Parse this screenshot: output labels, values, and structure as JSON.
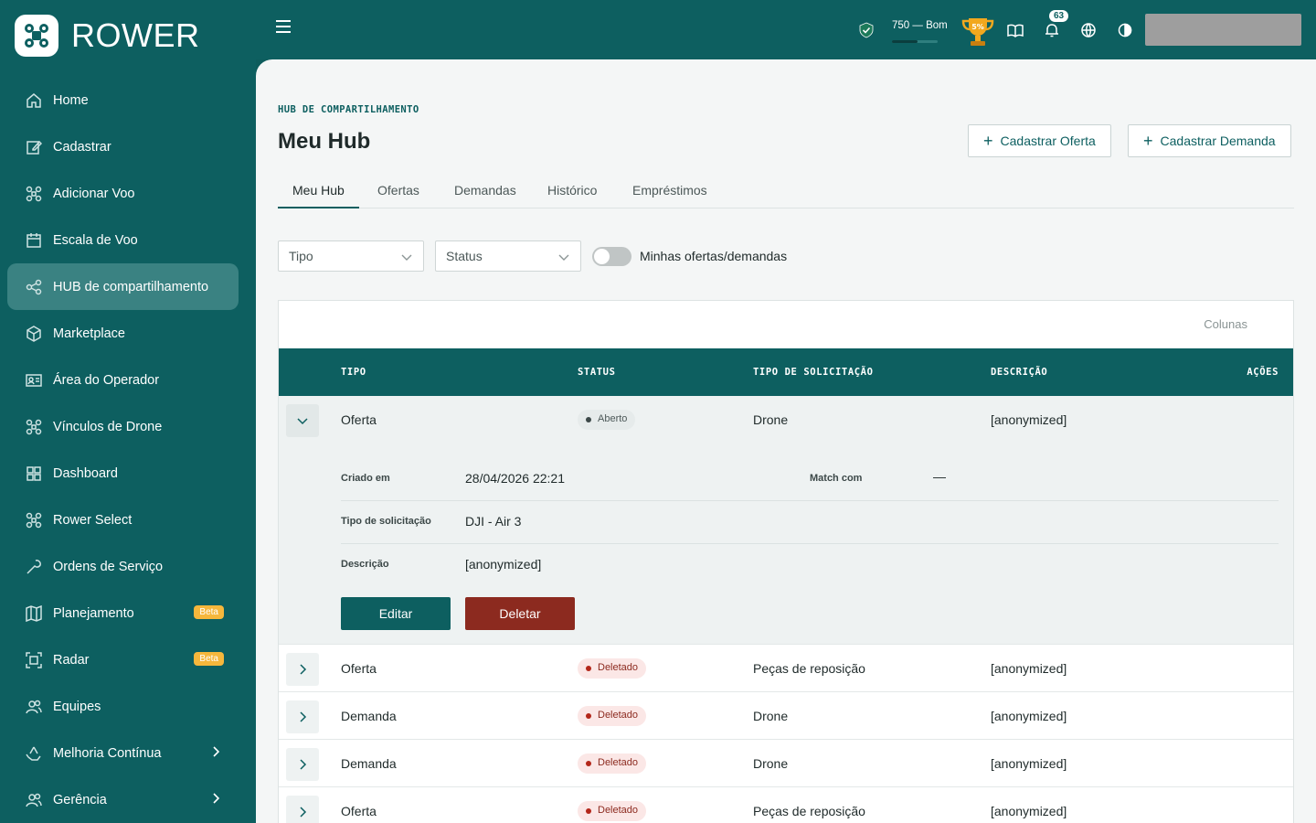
{
  "brand": {
    "name": "ROWER"
  },
  "sidebar": {
    "items": [
      {
        "label": "Home",
        "icon": "home-icon"
      },
      {
        "label": "Cadastrar",
        "icon": "edit-icon"
      },
      {
        "label": "Adicionar Voo",
        "icon": "drone-icon"
      },
      {
        "label": "Escala de Voo",
        "icon": "calendar-icon"
      },
      {
        "label": "HUB de compartilhamento",
        "icon": "share-icon",
        "active": true
      },
      {
        "label": "Marketplace",
        "icon": "box-icon"
      },
      {
        "label": "Área do Operador",
        "icon": "id-card-icon"
      },
      {
        "label": "Vínculos de Drone",
        "icon": "drone-icon"
      },
      {
        "label": "Dashboard",
        "icon": "grid-icon"
      },
      {
        "label": "Rower Select",
        "icon": "drone-icon"
      },
      {
        "label": "Ordens de Serviço",
        "icon": "wrench-icon"
      },
      {
        "label": "Planejamento",
        "icon": "map-icon",
        "badge": "Beta"
      },
      {
        "label": "Radar",
        "icon": "radar-icon",
        "badge": "Beta"
      },
      {
        "label": "Equipes",
        "icon": "team-icon"
      },
      {
        "label": "Melhoria Contínua",
        "icon": "recycle-icon",
        "chevron": true
      },
      {
        "label": "Gerência",
        "icon": "team-icon",
        "chevron": true
      }
    ]
  },
  "topbar": {
    "score_text": "750 — Bom",
    "score_fraction": 0.56,
    "trophy_badge": "5%",
    "notifications_count": "63"
  },
  "page": {
    "overline": "HUB DE COMPARTILHAMENTO",
    "title": "Meu Hub",
    "actions": {
      "offer": "Cadastrar Oferta",
      "demand": "Cadastrar Demanda"
    },
    "tabs": [
      "Meu Hub",
      "Ofertas",
      "Demandas",
      "Histórico",
      "Empréstimos"
    ],
    "filters": {
      "type": "Tipo",
      "status": "Status",
      "toggle_label": "Minhas ofertas/demandas"
    }
  },
  "table": {
    "columns_button": "Colunas",
    "headers": [
      "TIPO",
      "STATUS",
      "TIPO DE SOLICITAÇÃO",
      "DESCRIÇÃO",
      "AÇÕES"
    ],
    "rows": [
      {
        "tipo": "Oferta",
        "status": "Aberto",
        "status_kind": "open",
        "solicitacao": "Drone",
        "descricao": "[anonymized]",
        "expanded": true
      },
      {
        "tipo": "Oferta",
        "status": "Deletado",
        "status_kind": "deleted",
        "solicitacao": "Peças de reposição",
        "descricao": "[anonymized]"
      },
      {
        "tipo": "Demanda",
        "status": "Deletado",
        "status_kind": "deleted",
        "solicitacao": "Drone",
        "descricao": "[anonymized]"
      },
      {
        "tipo": "Demanda",
        "status": "Deletado",
        "status_kind": "deleted",
        "solicitacao": "Drone",
        "descricao": "[anonymized]"
      },
      {
        "tipo": "Oferta",
        "status": "Deletado",
        "status_kind": "deleted",
        "solicitacao": "Peças de reposição",
        "descricao": "[anonymized]"
      }
    ],
    "detail": {
      "created_label": "Criado em",
      "created_value": "28/04/2026 22:21",
      "match_label": "Match com",
      "match_value": "—",
      "request_label": "Tipo de solicitação",
      "request_value": "DJI - Air 3",
      "desc_label": "Descrição",
      "desc_value": "[anonymized]",
      "edit": "Editar",
      "delete": "Deletar"
    }
  },
  "colors": {
    "primary": "#0d5f60",
    "danger": "#8c2a1f",
    "beta": "#f6b73c"
  }
}
